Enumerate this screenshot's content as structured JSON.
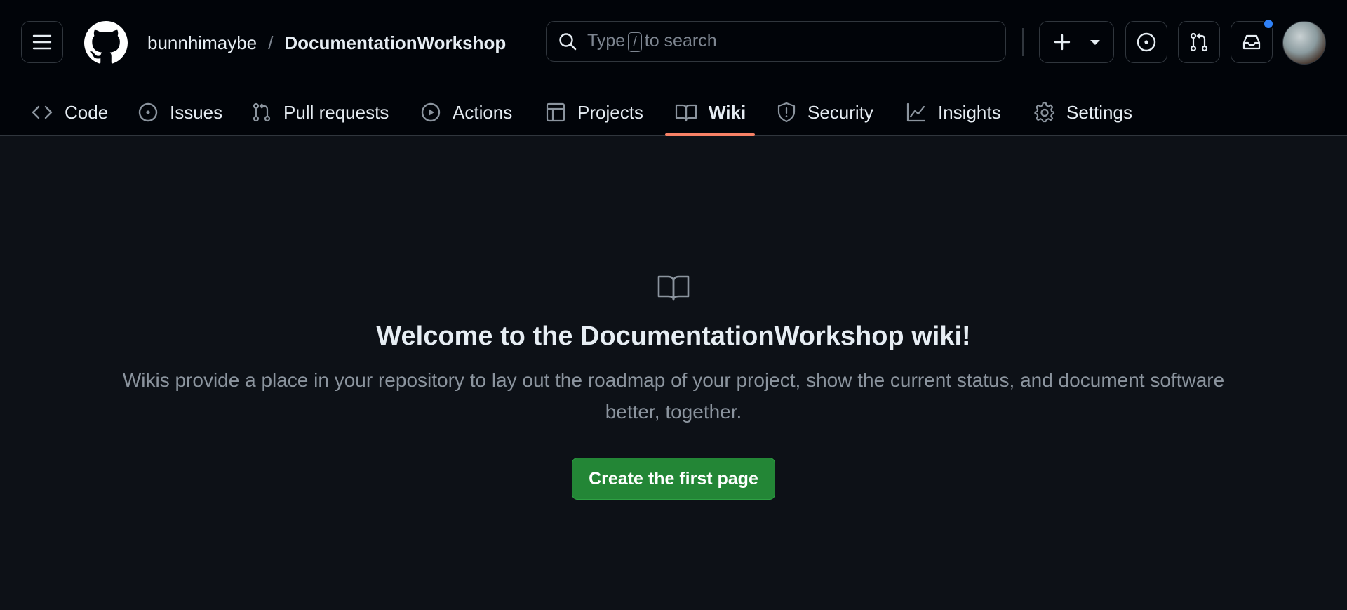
{
  "header": {
    "owner": "bunnhimaybe",
    "separator": "/",
    "repo": "DocumentationWorkshop",
    "search": {
      "prefix": "Type",
      "key": "/",
      "suffix": "to search"
    },
    "icons": [
      "menu-icon",
      "github-logo",
      "search-icon",
      "plus-icon",
      "triangle-down-icon",
      "issue-opened-icon",
      "git-pull-request-icon",
      "inbox-icon"
    ],
    "notification_color": "#2f81f7"
  },
  "tabs": [
    {
      "label": "Code",
      "icon": "code-icon"
    },
    {
      "label": "Issues",
      "icon": "issue-opened-icon"
    },
    {
      "label": "Pull requests",
      "icon": "git-pull-request-icon"
    },
    {
      "label": "Actions",
      "icon": "play-icon"
    },
    {
      "label": "Projects",
      "icon": "table-icon"
    },
    {
      "label": "Wiki",
      "icon": "book-icon",
      "active": true
    },
    {
      "label": "Security",
      "icon": "shield-icon"
    },
    {
      "label": "Insights",
      "icon": "graph-icon"
    },
    {
      "label": "Settings",
      "icon": "gear-icon"
    }
  ],
  "main": {
    "icon": "book-icon",
    "title": "Welcome to the DocumentationWorkshop wiki!",
    "description": "Wikis provide a place in your repository to lay out the roadmap of your project, show the current status, and document software better, together.",
    "button_label": "Create the first page"
  },
  "colors": {
    "background": "#0d1117",
    "header_bg": "#010409",
    "accent_underline": "#f78166",
    "primary_button": "#238636"
  }
}
